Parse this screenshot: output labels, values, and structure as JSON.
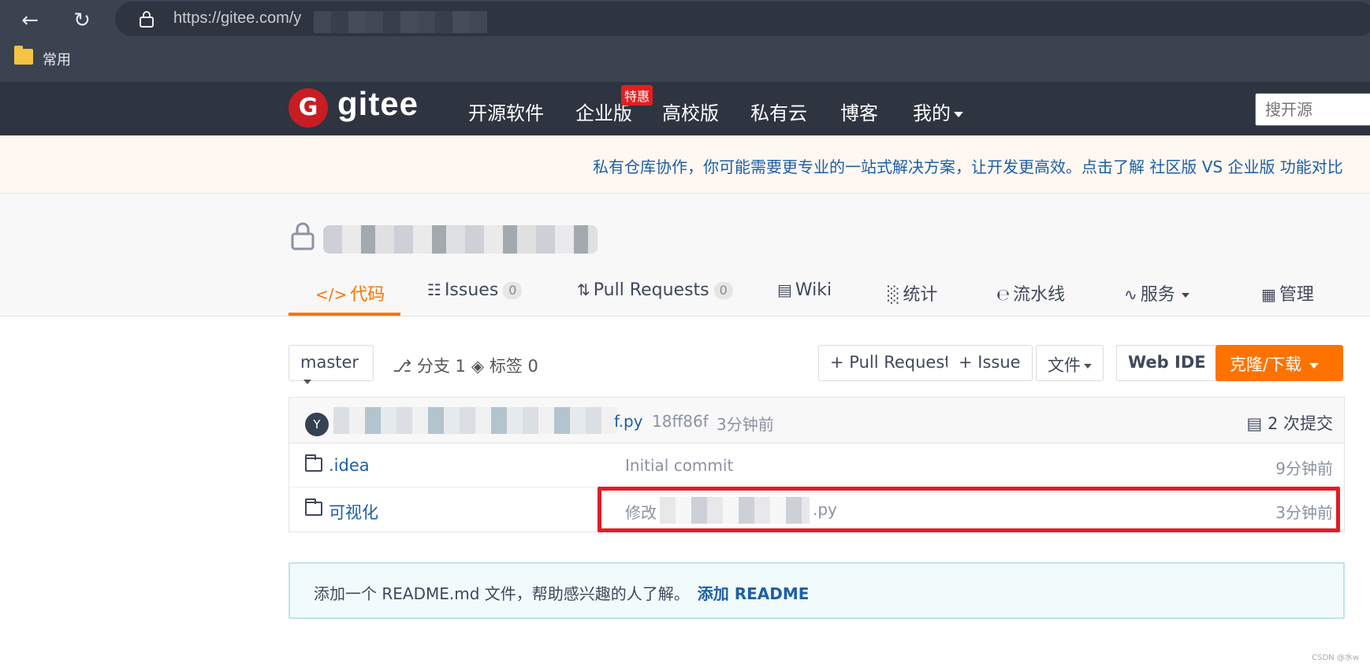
{
  "browser": {
    "url": "https://gitee.com/y",
    "bookmark_folder": "常用"
  },
  "header": {
    "logo": "gitee",
    "nav": [
      {
        "label": "开源软件"
      },
      {
        "label": "企业版"
      },
      {
        "label": "高校版"
      },
      {
        "label": "私有云"
      },
      {
        "label": "博客"
      },
      {
        "label": "我的"
      }
    ],
    "promo_badge": "特惠",
    "search_placeholder": "搜开源"
  },
  "banner": {
    "text": "私有仓库协作，你可能需要更专业的一站式解决方案，让开发更高效。点击了解 社区版 VS 企业版 功能对比"
  },
  "repo": {
    "tabs": [
      {
        "label": "代码",
        "active": true
      },
      {
        "label": "Issues",
        "count": "0"
      },
      {
        "label": "Pull Requests",
        "count": "0"
      },
      {
        "label": "Wiki"
      },
      {
        "label": "统计"
      },
      {
        "label": "流水线"
      },
      {
        "label": "服务"
      },
      {
        "label": "管理"
      }
    ]
  },
  "toolbar": {
    "branch": "master",
    "branches": "分支 1",
    "tags": "标签 0",
    "pull_request": "+ Pull Request",
    "issue": "+ Issue",
    "file": "文件",
    "web_ide": "Web IDE",
    "clone": "克隆/下载"
  },
  "commit": {
    "avatar_initial": "Y",
    "file_suffix": "f.py",
    "hash": "18ff86f",
    "time": "3分钟前",
    "count": "2 次提交"
  },
  "files": [
    {
      "name": ".idea",
      "message": "Initial commit",
      "time": "9分钟前"
    },
    {
      "name": "可视化",
      "message_prefix": "修改",
      "message_suffix": ".py",
      "time": "3分钟前"
    }
  ],
  "readme": {
    "text": "添加一个 README.md 文件，帮助感兴趣的人了解。",
    "link": "添加 README"
  },
  "watermark": "CSDN @水w",
  "colors": {
    "accent": "#fe7300",
    "header_bg": "#2e3440",
    "link": "#1d5fa6",
    "highlight": "#e31c25"
  }
}
